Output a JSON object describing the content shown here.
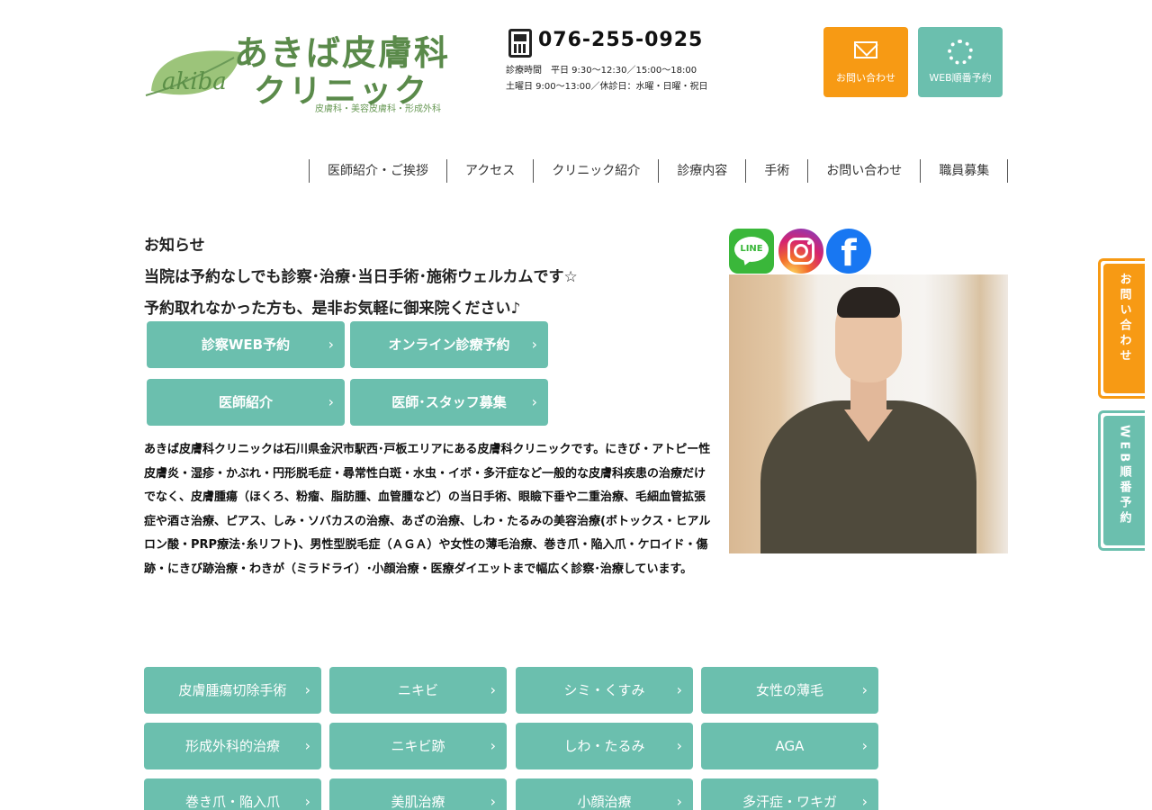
{
  "header": {
    "logo": {
      "leaf_text": "akiba",
      "title_line1": "あきば皮膚科",
      "title_line2": "クリニック",
      "subtitle": "皮膚科・美容皮膚科・形成外科",
      "brand_color": "#5a8a4a"
    },
    "phone": {
      "number": "076-255-0925",
      "hours_line1": "診療時間　平日 9:30〜12:30／15:00〜18:00",
      "hours_line2": "土曜日 9:00〜13:00／休診日：水曜・日曜・祝日"
    },
    "buttons": {
      "contact_label": "お問い合わせ",
      "web_label": "WEB順番予約"
    }
  },
  "nav": {
    "items": [
      {
        "label": "医師紹介・ご挨拶"
      },
      {
        "label": "アクセス"
      },
      {
        "label": "クリニック紹介"
      },
      {
        "label": "診療内容"
      },
      {
        "label": "手術"
      },
      {
        "label": "お問い合わせ"
      },
      {
        "label": "職員募集"
      }
    ]
  },
  "notice": {
    "title": "お知らせ",
    "line1": "当院は予約なしでも診察･治療･当日手術･施術ウェルカムです☆",
    "line2": "予約取れなかった方も、是非お気軽に御来院ください♪",
    "buttons": [
      {
        "label": "診察WEB予約"
      },
      {
        "label": "オンライン診療予約"
      },
      {
        "label": "医師紹介"
      },
      {
        "label": "医師･スタッフ募集"
      }
    ]
  },
  "intro_text": "あきば皮膚科クリニックは石川県金沢市駅西･戸板エリアにある皮膚科クリニックです。にきび・アトピー性皮膚炎・湿疹・かぶれ・円形脱毛症・尋常性白斑・水虫・イボ・多汗症など一般的な皮膚科疾患の治療だけでなく、皮膚腫瘍（ほくろ、粉瘤、脂肪腫、血管腫など）の当日手術、眼瞼下垂や二重治療、毛細血管拡張症や酒さ治療、ピアス、しみ・ソバカスの治療、あざの治療、しわ・たるみの美容治療(ボトックス・ヒアルロン酸・PRP療法･糸リフト)、男性型脱毛症（ＡＧＡ）や女性の薄毛治療、巻き爪・陥入爪・ケロイド・傷跡・にきび跡治療・わきが（ミラドライ）･小顔治療・医療ダイエットまで幅広く診察･治療しています。",
  "social": {
    "line_label": "LINE",
    "facebook_glyph": "f"
  },
  "side_tabs": {
    "contact": "お問い合わせ",
    "web": "WEB順番予約"
  },
  "treatments": [
    {
      "label": "皮膚腫瘍切除手術"
    },
    {
      "label": "ニキビ"
    },
    {
      "label": "シミ・くすみ"
    },
    {
      "label": "女性の薄毛"
    },
    {
      "label": "形成外科的治療"
    },
    {
      "label": "ニキビ跡"
    },
    {
      "label": "しわ・たるみ"
    },
    {
      "label": "AGA"
    },
    {
      "label": "巻き爪・陥入爪"
    },
    {
      "label": "美肌治療"
    },
    {
      "label": "小顔治療"
    },
    {
      "label": "多汗症・ワキガ"
    }
  ],
  "chevron": "›",
  "colors": {
    "teal": "#6bbfae",
    "orange": "#f79a14"
  }
}
